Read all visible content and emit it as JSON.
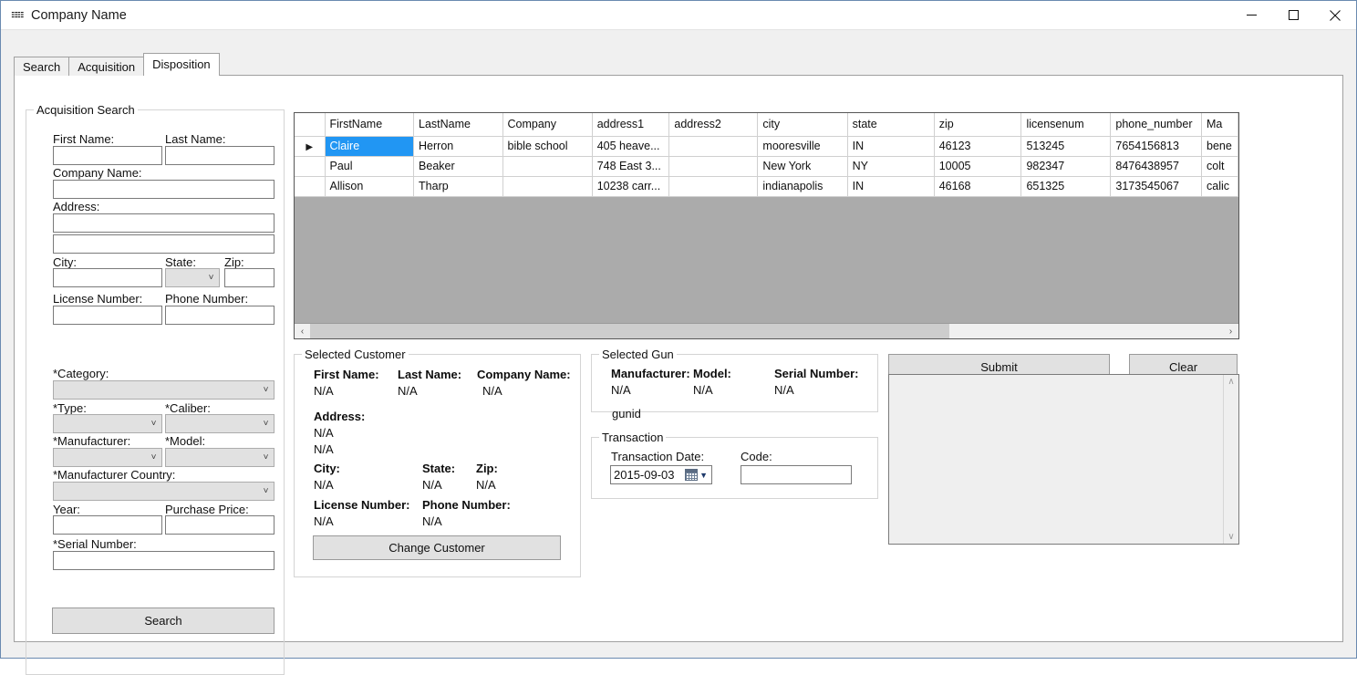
{
  "window": {
    "title": "Company Name",
    "app_icon": "app-icon",
    "minimize_label": "—",
    "maximize_label": "□",
    "close_label": "✕"
  },
  "tabs": [
    {
      "label": "Search",
      "active": false
    },
    {
      "label": "Acquisition",
      "active": false
    },
    {
      "label": "Disposition",
      "active": true
    }
  ],
  "acquisition_search": {
    "title": "Acquisition Search",
    "first_name_label": "First Name:",
    "first_name_value": "",
    "last_name_label": "Last Name:",
    "last_name_value": "",
    "company_name_label": "Company Name:",
    "company_name_value": "",
    "address_label": "Address:",
    "address1_value": "",
    "address2_value": "",
    "city_label": "City:",
    "city_value": "",
    "state_label": "State:",
    "state_value": "",
    "zip_label": "Zip:",
    "zip_value": "",
    "license_number_label": "License Number:",
    "license_number_value": "",
    "phone_number_label": "Phone Number:",
    "phone_number_value": "",
    "category_label": "*Category:",
    "category_value": "",
    "type_label": "*Type:",
    "type_value": "",
    "caliber_label": "*Caliber:",
    "caliber_value": "",
    "manufacturer_label": "*Manufacturer:",
    "manufacturer_value": "",
    "model_label": "*Model:",
    "model_value": "",
    "manufacturer_country_label": "*Manufacturer Country:",
    "manufacturer_country_value": "",
    "year_label": "Year:",
    "year_value": "",
    "purchase_price_label": "Purchase Price:",
    "purchase_price_value": "",
    "serial_number_label": "*Serial Number:",
    "serial_number_value": "",
    "search_button": "Search"
  },
  "grid": {
    "columns": [
      "FirstName",
      "LastName",
      "Company",
      "address1",
      "address2",
      "city",
      "state",
      "zip",
      "licensenum",
      "phone_number",
      "Ma"
    ],
    "rows": [
      {
        "selected": true,
        "indicator": "▶",
        "cells": [
          "Claire",
          "Herron",
          "bible school",
          "405 heave...",
          "",
          "mooresville",
          "IN",
          "46123",
          "513245",
          "7654156813",
          "bene"
        ]
      },
      {
        "selected": false,
        "indicator": "",
        "cells": [
          "Paul",
          "Beaker",
          "",
          "748 East 3...",
          "",
          "New York",
          "NY",
          "10005",
          "982347",
          "8476438957",
          "colt"
        ]
      },
      {
        "selected": false,
        "indicator": "",
        "cells": [
          "Allison",
          "Tharp",
          "",
          "10238 carr...",
          "",
          "indianapolis",
          "IN",
          "46168",
          "651325",
          "3173545067",
          "calic"
        ]
      }
    ],
    "scroll_left_icon": "‹",
    "scroll_right_icon": "›",
    "selection_color": "#2196f3",
    "empty_area_color": "#ababab"
  },
  "selected_customer": {
    "title": "Selected Customer",
    "first_name_label": "First Name:",
    "first_name_value": "N/A",
    "last_name_label": "Last Name:",
    "last_name_value": "N/A",
    "company_name_label": "Company Name:",
    "company_name_value": "N/A",
    "address_label": "Address:",
    "address1_value": "N/A",
    "address2_value": "N/A",
    "city_label": "City:",
    "city_value": "N/A",
    "state_label": "State:",
    "state_value": "N/A",
    "zip_label": "Zip:",
    "zip_value": "N/A",
    "license_number_label": "License Number:",
    "license_number_value": "N/A",
    "phone_number_label": "Phone Number:",
    "phone_number_value": "N/A",
    "change_customer_button": "Change Customer"
  },
  "selected_gun": {
    "title": "Selected Gun",
    "manufacturer_label": "Manufacturer:",
    "manufacturer_value": "N/A",
    "model_label": "Model:",
    "model_value": "N/A",
    "serial_number_label": "Serial Number:",
    "serial_number_value": "N/A",
    "gunid_label": "gunid"
  },
  "transaction": {
    "title": "Transaction",
    "transaction_date_label": "Transaction Date:",
    "transaction_date_value": "2015-09-03",
    "code_label": "Code:",
    "code_value": ""
  },
  "actions": {
    "submit_label": "Submit",
    "clear_label": "Clear"
  },
  "log": {
    "value": "",
    "scroll_up_icon": "∧",
    "scroll_down_icon": "∨"
  }
}
